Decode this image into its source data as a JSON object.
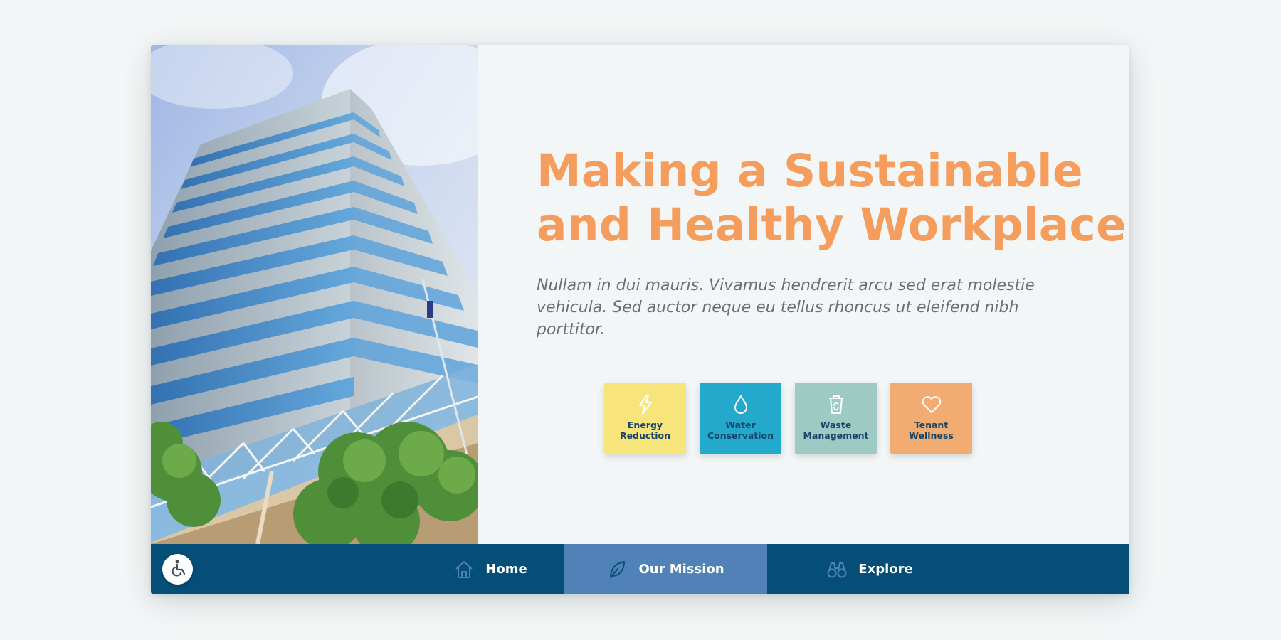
{
  "hero": {
    "title_line1": "Making a Sustainable",
    "title_line2": "and Healthy Workplace",
    "subtitle": "Nullam in dui mauris. Vivamus hendrerit arcu sed erat molestie vehicula. Sed auctor neque eu tellus rhoncus ut eleifend nibh porttitor.",
    "title_color": "#f49d5c"
  },
  "tiles": [
    {
      "label": "Energy\nReduction",
      "icon": "lightning-icon",
      "color": "#f7e47a"
    },
    {
      "label": "Water\nConservation",
      "icon": "water-drop-icon",
      "color": "#22a9cb"
    },
    {
      "label": "Waste\nManagement",
      "icon": "recycle-bin-icon",
      "color": "#9dcbc3"
    },
    {
      "label": "Tenant\nWellness",
      "icon": "heart-icon",
      "color": "#f2ac71"
    }
  ],
  "nav": {
    "items": [
      {
        "label": "Home",
        "icon": "home-icon",
        "active": false
      },
      {
        "label": "Our Mission",
        "icon": "leaf-icon",
        "active": true
      },
      {
        "label": "Explore",
        "icon": "binoculars-icon",
        "active": false
      }
    ],
    "accessibility_icon": "wheelchair-icon",
    "background": "#054e78",
    "active_background": "#5082b7"
  }
}
